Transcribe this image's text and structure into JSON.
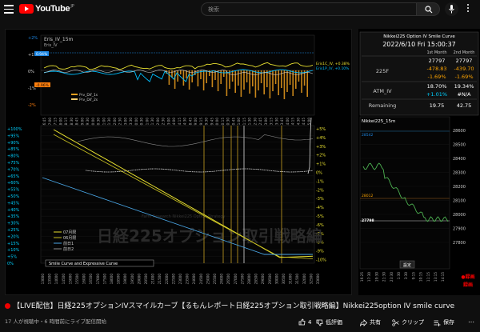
{
  "header": {
    "logo_text": "YouTube",
    "logo_region": "JP",
    "search_placeholder": "検索"
  },
  "video": {
    "panel_title": "Eris_IV_15m",
    "legend_eris_iv": "Eris_IV",
    "top_axis": [
      "+2%",
      "+1%",
      "0%",
      "-1%",
      "-2%"
    ],
    "badge_upper": "0.94%",
    "badge_lower": "-0.96%",
    "eris_1c": "Eris1C_IV, +0.38%",
    "eris_1p": "Eris1P_IV, +0.10%",
    "prv_dif_1": "Prv_Dif_1s",
    "prv_dif_2": "Prv_Dif_2s",
    "top_times": [
      "16:45",
      "17:00",
      "17:15",
      "18:00",
      "18:15",
      "18:30",
      "18:45",
      "19:00",
      "19:30",
      "20:00",
      "20:30",
      "21:00",
      "21:30",
      "22:00",
      "22:30",
      "23:00",
      "23:30",
      "0:00",
      "0:30",
      "1:00",
      "1:30",
      "2:00",
      "2:30",
      "3:00",
      "4:00",
      "4:15",
      "4:30",
      "8:45",
      "9:00",
      "9:15",
      "9:30",
      "9:45",
      "10:00",
      "10:15",
      "10:30",
      "10:45",
      "11:00",
      "11:15",
      "11:30",
      "12:30",
      "12:45",
      "13:00",
      "13:15",
      "13:30",
      "13:45",
      "14:00",
      "14:15",
      "14:30",
      "14:45",
      "15:00"
    ],
    "left_axis": [
      "+100%",
      "+95%",
      "+90%",
      "+85%",
      "+80%",
      "+75%",
      "+70%",
      "+65%",
      "+60%",
      "+55%",
      "+50%",
      "+45%",
      "+40%",
      "+35%",
      "+30%",
      "+25%",
      "+20%",
      "+15%",
      "+10%",
      "+5%",
      "0%"
    ],
    "right_axis": [
      "+5%",
      "+4%",
      "+3%",
      "+2%",
      "+1%",
      "0%",
      "-1%",
      "-2%",
      "-3%",
      "-4%",
      "-5%",
      "-6%",
      "-7%",
      "-8%",
      "-9%",
      "-10%"
    ],
    "bottom_strikes": [
      "13000",
      "13500",
      "14000",
      "14500",
      "15000",
      "15500",
      "16000",
      "16500",
      "17000",
      "17500",
      "18000",
      "18500",
      "19000",
      "19500",
      "20000",
      "20500",
      "21000",
      "21500",
      "22000",
      "22500",
      "23000",
      "23500",
      "24000",
      "24500",
      "25000",
      "25500",
      "26000",
      "26500",
      "27000",
      "27500",
      "28000",
      "28500",
      "29000",
      "29500",
      "30000",
      "30500",
      "31000",
      "31500",
      "32000",
      "32500",
      "33000"
    ],
    "legend_items": [
      "07月限",
      "06月限",
      "前日1",
      "前日2"
    ],
    "smile_title": "Smile Curve and Expressive Curve",
    "watermark": "日経225オプション取引戦略編",
    "watermark_small": "Farm Research Nikkei225 Option Strategy"
  },
  "sidepanel": {
    "table_title": "Nikkei225 Option IV Smile Curve",
    "datetime": "2022/6/10 Fri 15:00:37",
    "col_1": "1st Month",
    "col_2": "2nd Month",
    "label_225f": "225F",
    "f_val_1": "27797",
    "f_val_2": "27797",
    "f_chg_1": "-478.83",
    "f_chg_2": "-439.70",
    "f_pct_1": "-1.69%",
    "f_pct_2": "-1.69%",
    "label_atm": "ATM_IV",
    "atm_1": "18.70%",
    "atm_2": "19.34%",
    "atm_chg_1": "+1.01%",
    "atm_chg_2": "#N/A",
    "label_remaining": "Remaining",
    "rem_1": "19.75",
    "rem_2": "42.75",
    "mini_title": "Nikkei225_15m",
    "mini_axis": [
      "28600",
      "28500",
      "28400",
      "28300",
      "28200",
      "28100",
      "28000",
      "27900",
      "27800"
    ],
    "mini_label_hi": "28542",
    "mini_label_mid": "28012",
    "mini_label_last": "27798",
    "mini_times": [
      "16:25",
      "17:30",
      "19:30",
      "21:30",
      "23:30",
      "1:30",
      "3:30",
      "9:15",
      "10:15",
      "11:15",
      "13:15",
      "14:15"
    ],
    "settings_label": "設定",
    "record_label": "●録画",
    "record_sub": "録画"
  },
  "title": {
    "text": "【LIVE配信】日経225オプションIVスマイルカーブ【るもんレポート日経225オプション取引戦略編】Nikkei225option IV smile curve"
  },
  "meta": {
    "text": "17 人が視聴中・6 時間前にライブ配信開始"
  },
  "actions": {
    "like_count": "4",
    "dislike_label": "低評価",
    "share_label": "共有",
    "clip_label": "クリップ",
    "save_label": "保存"
  },
  "colors": {
    "background": "#0f0f0f",
    "brand": "#ff0000",
    "cyan": "#00d0ff",
    "orange": "#ffa500",
    "yellow": "#e8e030",
    "green": "#00ff40"
  }
}
